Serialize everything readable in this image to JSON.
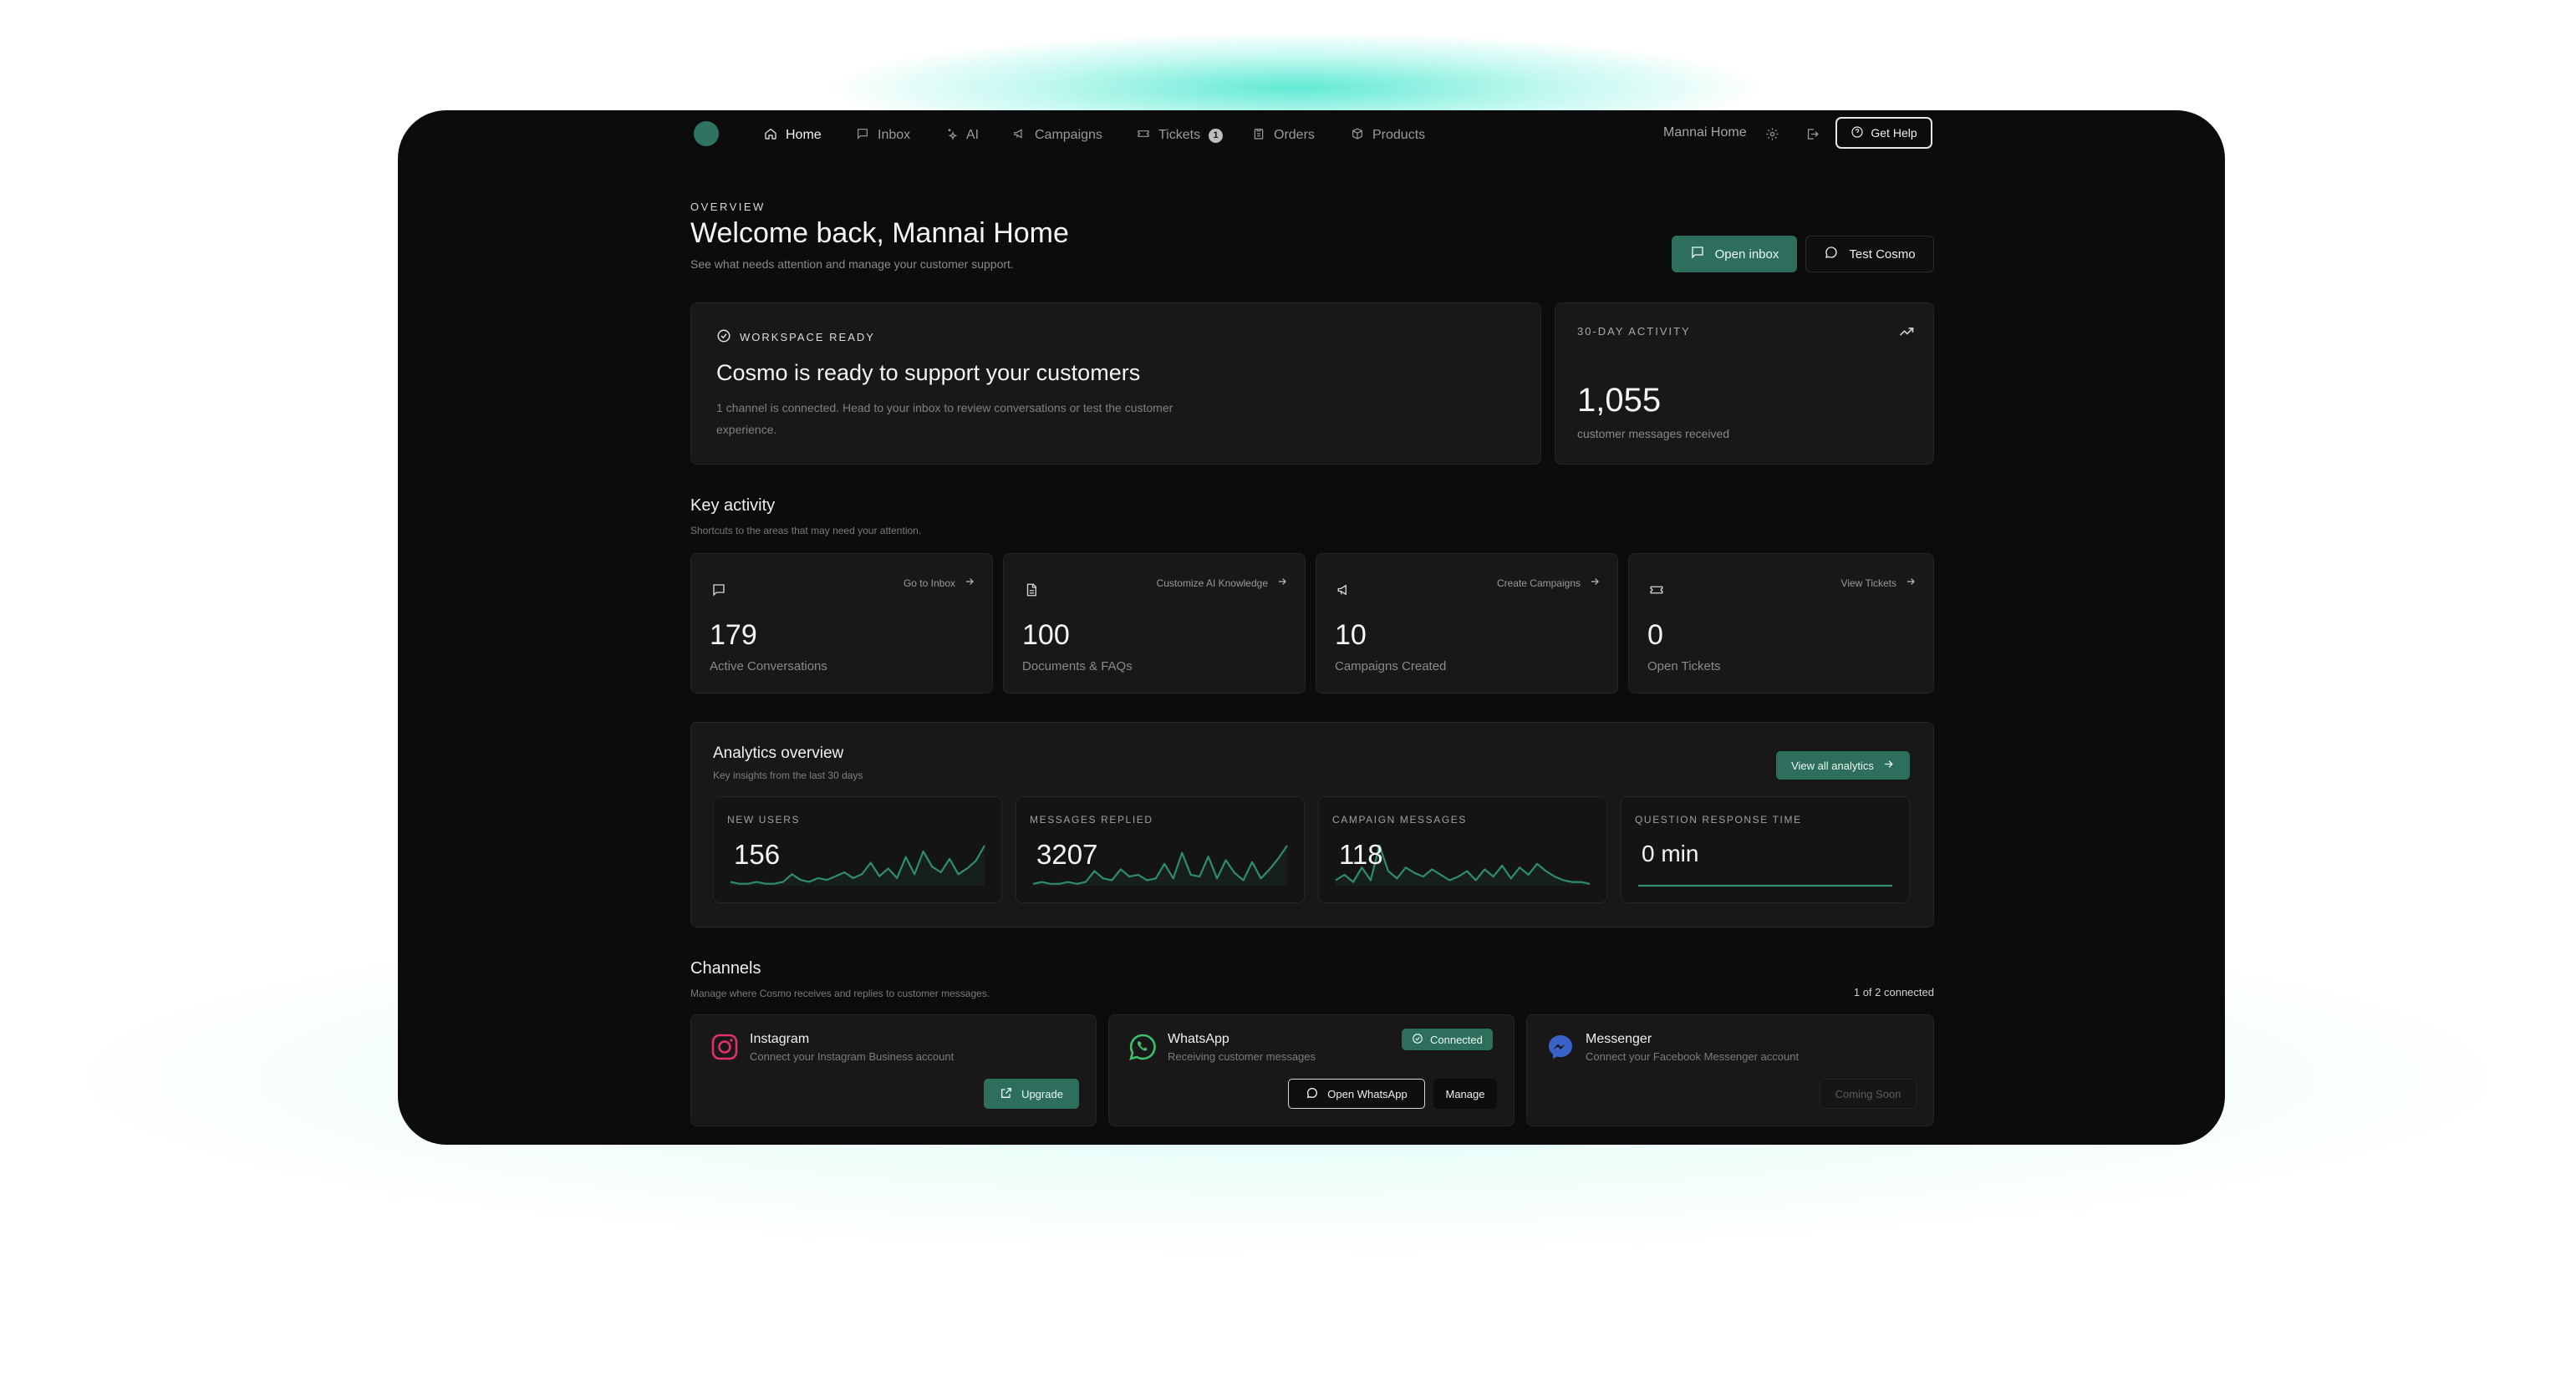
{
  "nav": {
    "items": [
      {
        "label": "Home",
        "icon": "home-icon"
      },
      {
        "label": "Inbox",
        "icon": "inbox-icon"
      },
      {
        "label": "AI",
        "icon": "sparkle-icon"
      },
      {
        "label": "Campaigns",
        "icon": "megaphone-icon"
      },
      {
        "label": "Tickets",
        "icon": "ticket-icon",
        "badge": "1"
      },
      {
        "label": "Orders",
        "icon": "clipboard-icon"
      },
      {
        "label": "Products",
        "icon": "box-icon"
      }
    ],
    "workspace_name": "Mannai Home",
    "help_label": "Get Help"
  },
  "header": {
    "eyebrow": "OVERVIEW",
    "title": "Welcome back, Mannai Home",
    "subtitle": "See what needs attention and manage your customer support.",
    "open_inbox_label": "Open inbox",
    "test_label": "Test Cosmo"
  },
  "workspace": {
    "status": "WORKSPACE READY",
    "title": "Cosmo is ready to support your customers",
    "description": "1 channel is connected. Head to your inbox to review conversations or test the customer experience."
  },
  "activity": {
    "label": "30-DAY ACTIVITY",
    "value": "1,055",
    "caption": "customer messages received"
  },
  "key_activity": {
    "title": "Key activity",
    "subtitle": "Shortcuts to the areas that may need your attention.",
    "cards": [
      {
        "icon": "chat-icon",
        "link": "Go to Inbox",
        "value": "179",
        "caption": "Active Conversations"
      },
      {
        "icon": "document-icon",
        "link": "Customize AI Knowledge",
        "value": "100",
        "caption": "Documents & FAQs"
      },
      {
        "icon": "megaphone-icon",
        "link": "Create Campaigns",
        "value": "10",
        "caption": "Campaigns Created"
      },
      {
        "icon": "ticket-icon",
        "link": "View Tickets",
        "value": "0",
        "caption": "Open Tickets"
      }
    ]
  },
  "analytics": {
    "title": "Analytics overview",
    "subtitle": "Key insights from the last 30 days",
    "button_label": "View all analytics",
    "metrics": [
      {
        "label": "NEW USERS",
        "value": "156",
        "trend": [
          2,
          1,
          1,
          2,
          1,
          1,
          2,
          6,
          3,
          2,
          4,
          3,
          5,
          7,
          4,
          6,
          12,
          5,
          9,
          4,
          15,
          6,
          18,
          10,
          7,
          14,
          6,
          9,
          13,
          21
        ]
      },
      {
        "label": "MESSAGES REPLIED",
        "value": "3207",
        "trend": [
          1,
          2,
          1,
          1,
          2,
          1,
          2,
          8,
          4,
          3,
          9,
          5,
          6,
          3,
          4,
          12,
          4,
          18,
          6,
          5,
          16,
          4,
          14,
          7,
          3,
          13,
          4,
          9,
          15,
          22
        ]
      },
      {
        "label": "CAMPAIGN MESSAGES",
        "value": "118",
        "trend": [
          3,
          6,
          2,
          10,
          3,
          22,
          8,
          4,
          10,
          7,
          5,
          9,
          6,
          3,
          5,
          8,
          3,
          9,
          5,
          11,
          4,
          10,
          6,
          12,
          8,
          5,
          3,
          2,
          2,
          1
        ]
      },
      {
        "label": "QUESTION RESPONSE TIME",
        "value": "0 min",
        "trend": [
          0,
          0,
          0,
          0,
          0,
          0,
          0,
          0,
          0,
          0,
          0,
          0,
          0,
          0,
          0,
          0,
          0,
          0,
          0,
          0,
          0,
          0,
          0,
          0,
          0,
          0,
          0,
          0,
          0,
          0
        ]
      }
    ]
  },
  "channels": {
    "title": "Channels",
    "subtitle": "Manage where Cosmo receives and replies to customer messages.",
    "connected_count": "1 of 2 connected",
    "items": [
      {
        "name": "Instagram",
        "description": "Connect your Instagram Business account",
        "action": "Upgrade"
      },
      {
        "name": "WhatsApp",
        "description": "Receiving customer messages",
        "status": "Connected",
        "action": "Open WhatsApp",
        "secondary_action": "Manage"
      },
      {
        "name": "Messenger",
        "description": "Connect your Facebook Messenger account",
        "action": "Coming Soon"
      }
    ]
  },
  "colors": {
    "accent": "#2e6e5d",
    "sparkline": "#2f8c6f",
    "background": "#0c0c0c",
    "card": "#181818"
  }
}
